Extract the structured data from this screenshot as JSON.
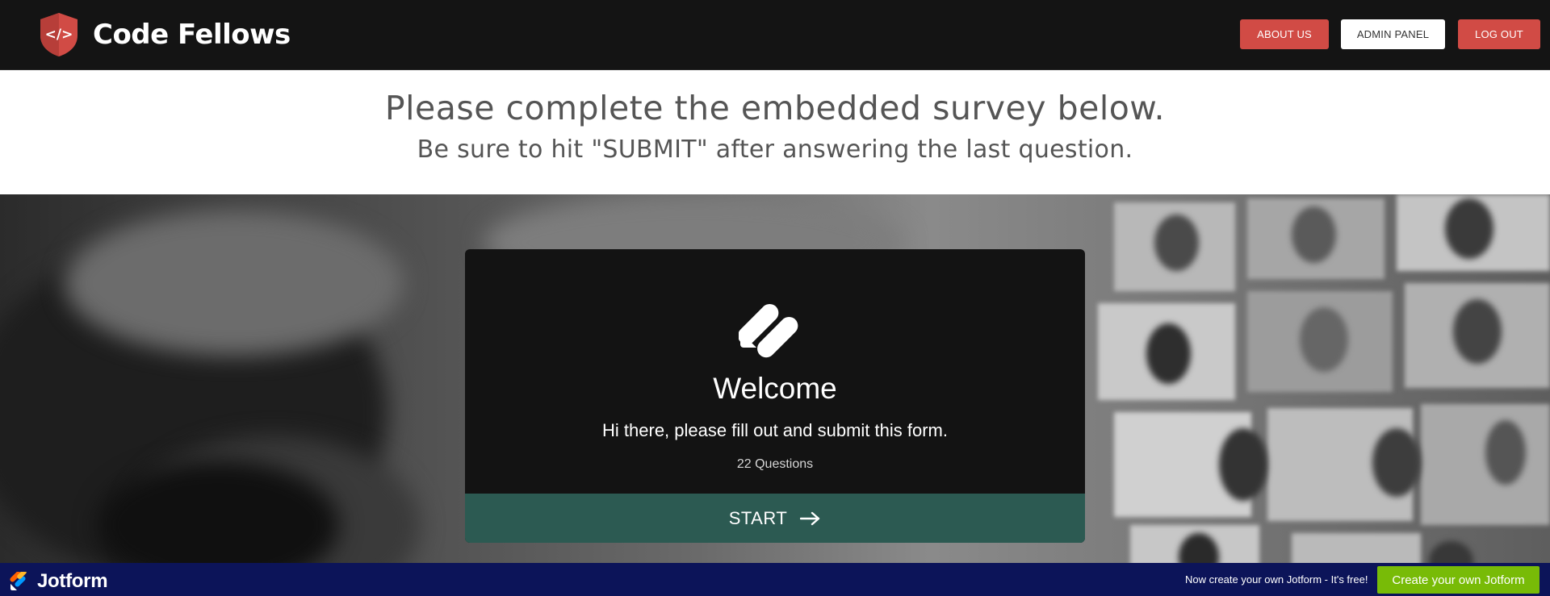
{
  "header": {
    "brand": "Code Fellows",
    "nav": {
      "about": "ABOUT US",
      "admin": "ADMIN PANEL",
      "logout": "LOG OUT"
    }
  },
  "intro": {
    "title": "Please complete the embedded survey below.",
    "subtitle": "Be sure to hit \"SUBMIT\" after answering the last question."
  },
  "form": {
    "title": "Welcome",
    "description": "Hi there, please fill out and submit this form.",
    "question_count": "22 Questions",
    "start_label": "START"
  },
  "jotform_bar": {
    "brand": "Jotform",
    "note": "Now create your own Jotform - It's free!",
    "cta": "Create your own Jotform"
  },
  "colors": {
    "brand_red": "#d14b45",
    "header_bg": "#141414",
    "start_green": "#2c5a52",
    "jotform_navy": "#0c1459",
    "jotform_green": "#78bb07"
  },
  "icons": {
    "brand_logo": "code-shield-icon",
    "form_logo": "jotform-icon",
    "start_arrow": "arrow-right-icon"
  }
}
